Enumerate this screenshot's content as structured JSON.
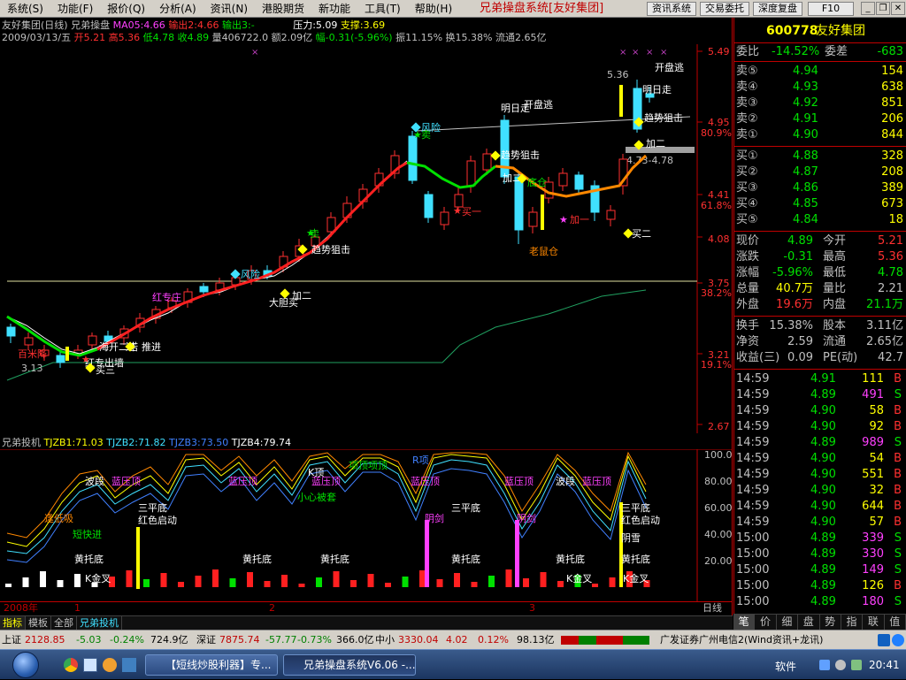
{
  "menu": {
    "items": [
      "系统(S)",
      "功能(F)",
      "报价(Q)",
      "分析(A)",
      "资讯(N)",
      "港股期货",
      "新功能",
      "工具(T)",
      "帮助(H)"
    ],
    "app_title": "兄弟操盘系统[友好集团]",
    "buttons": [
      "资讯系统",
      "交易委托",
      "深度复盘",
      "F10"
    ]
  },
  "info": {
    "stock_name": "友好集团(日线)",
    "system": "兄弟操盘",
    "ma": "MA05:4.66",
    "out2": "输出2:4.66",
    "out3": "输出3:-",
    "pressure": "压力:5.09",
    "support": "支撑:3.69",
    "date": "2009/03/13/五",
    "open": "开5.21",
    "high": "高5.36",
    "low": "低4.78",
    "close": "收4.89",
    "volume": "量406722.0",
    "amount": "额2.09亿",
    "amplitude_change": "幅-0.31(-5.96%)",
    "swing": "振11.15%",
    "turnover": "换15.38%",
    "float": "流通2.65亿"
  },
  "price_axis": {
    "labels": [
      "5.49",
      "4.95",
      "80.9%",
      "4.41",
      "61.8%",
      "4.08",
      "3.75",
      "38.2%",
      "3.21",
      "19.1%",
      "2.67"
    ],
    "current_box": "4.73-4.78"
  },
  "annotations": {
    "main": [
      "5.36",
      "开盘逃",
      "明日走",
      "趋势狙击",
      "加二",
      "风险",
      "卖",
      "明日走",
      "开盘逃",
      "趋势狙击",
      "加二",
      "底仓",
      "买一",
      "加一",
      "买二",
      "老鼠仓",
      "风险",
      "卖",
      "趋势狙击",
      "加二",
      "大胆买",
      "红专庄",
      "海开二诺",
      "进",
      "推进",
      "百米降",
      "3.13",
      "红专出墙",
      "买三"
    ],
    "indicator": [
      "波段",
      "蓝压顶",
      "蓝压顶",
      "K顶",
      "蓝压顶",
      "项顶项顶",
      "R项",
      "蓝压顶",
      "蓝压顶",
      "波段",
      "蓝压顶",
      "逢低吸",
      "短快进",
      "三平底",
      "红色启动",
      "小心被套",
      "阴剑",
      "三平底",
      "阴剑",
      "三平底",
      "红色启动",
      "阴雪",
      "黄托底",
      "黄托底",
      "黄托底",
      "黄托底",
      "黄托底",
      "黄托底",
      "K金叉",
      "K金叉",
      "K金叉"
    ]
  },
  "indicator": {
    "header_name": "兄弟投机",
    "tj1": "TJZB1:71.03",
    "tj2": "TJZB2:71.82",
    "tj3": "TJZB3:73.50",
    "tj4": "TJZB4:79.74",
    "axis": [
      "100.00",
      "80.00",
      "60.00",
      "40.00",
      "20.00"
    ]
  },
  "time_axis": {
    "labels": [
      "2008年",
      "1",
      "2",
      "3"
    ],
    "period": "日线"
  },
  "bottom_tabs": [
    "指标",
    "模板",
    "全部",
    "兄弟投机"
  ],
  "right_panel": {
    "code": "600778",
    "name": "友好集团",
    "weibi_label": "委比",
    "weibi": "-14.52%",
    "weicha_label": "委差",
    "weicha": "-683",
    "sells": [
      {
        "label": "卖⑤",
        "price": "4.94",
        "vol": "154"
      },
      {
        "label": "卖④",
        "price": "4.93",
        "vol": "638"
      },
      {
        "label": "卖③",
        "price": "4.92",
        "vol": "851"
      },
      {
        "label": "卖②",
        "price": "4.91",
        "vol": "206"
      },
      {
        "label": "卖①",
        "price": "4.90",
        "vol": "844"
      }
    ],
    "buys": [
      {
        "label": "买①",
        "price": "4.88",
        "vol": "328"
      },
      {
        "label": "买②",
        "price": "4.87",
        "vol": "208"
      },
      {
        "label": "买③",
        "price": "4.86",
        "vol": "389"
      },
      {
        "label": "买④",
        "price": "4.85",
        "vol": "673"
      },
      {
        "label": "买⑤",
        "price": "4.84",
        "vol": "18"
      }
    ],
    "stats": [
      {
        "l1": "现价",
        "v1": "4.89",
        "l2": "今开",
        "v2": "5.21"
      },
      {
        "l1": "涨跌",
        "v1": "-0.31",
        "l2": "最高",
        "v2": "5.36"
      },
      {
        "l1": "涨幅",
        "v1": "-5.96%",
        "l2": "最低",
        "v2": "4.78"
      },
      {
        "l1": "总量",
        "v1": "40.7万",
        "l2": "量比",
        "v2": "2.21"
      },
      {
        "l1": "外盘",
        "v1": "19.6万",
        "l2": "内盘",
        "v2": "21.1万"
      }
    ],
    "stats2": [
      {
        "l1": "换手",
        "v1": "15.38%",
        "l2": "股本",
        "v2": "3.11亿"
      },
      {
        "l1": "净资",
        "v1": "2.59",
        "l2": "流通",
        "v2": "2.65亿"
      },
      {
        "l1": "收益(三)",
        "v1": "0.09",
        "l2": "PE(动)",
        "v2": "42.7"
      }
    ],
    "ticks": [
      {
        "t": "14:59",
        "p": "4.91",
        "v": "111",
        "s": "B"
      },
      {
        "t": "14:59",
        "p": "4.89",
        "v": "491",
        "s": "S"
      },
      {
        "t": "14:59",
        "p": "4.90",
        "v": "58",
        "s": "B"
      },
      {
        "t": "14:59",
        "p": "4.90",
        "v": "92",
        "s": "B"
      },
      {
        "t": "14:59",
        "p": "4.89",
        "v": "989",
        "s": "S"
      },
      {
        "t": "14:59",
        "p": "4.90",
        "v": "54",
        "s": "B"
      },
      {
        "t": "14:59",
        "p": "4.90",
        "v": "551",
        "s": "B"
      },
      {
        "t": "14:59",
        "p": "4.90",
        "v": "32",
        "s": "B"
      },
      {
        "t": "14:59",
        "p": "4.90",
        "v": "644",
        "s": "B"
      },
      {
        "t": "14:59",
        "p": "4.90",
        "v": "57",
        "s": "B"
      },
      {
        "t": "15:00",
        "p": "4.89",
        "v": "339",
        "s": "S"
      },
      {
        "t": "15:00",
        "p": "4.89",
        "v": "330",
        "s": "S"
      },
      {
        "t": "15:00",
        "p": "4.89",
        "v": "149",
        "s": "S"
      },
      {
        "t": "15:00",
        "p": "4.89",
        "v": "126",
        "s": "B"
      },
      {
        "t": "15:00",
        "p": "4.89",
        "v": "180",
        "s": "S"
      }
    ],
    "tabs": [
      "笔",
      "价",
      "细",
      "盘",
      "势",
      "指",
      "联",
      "值"
    ]
  },
  "status": {
    "sh_label": "上证",
    "sh": "2128.85",
    "sh_chg": "-5.03",
    "sh_pct": "-0.24%",
    "sh_amt": "724.9亿",
    "sz_label": "深证",
    "sz": "7875.74",
    "sz_chg": "-57.77",
    "sz_pct": "-0.73%",
    "sz_amt": "366.0亿",
    "zx_label": "中小",
    "zx": "3330.04",
    "zx_chg": "4.02",
    "zx_pct": "0.12%",
    "zx_amt": "98.13亿",
    "broker": "广发证券广州电信2(Wind资讯+龙讯)"
  },
  "taskbar": {
    "btn1": "【短线炒股利器】专...",
    "btn2": "兄弟操盘系统V6.06 -...",
    "tray_label": "软件",
    "clock": "20:41"
  },
  "colors": {
    "up": "#ff3030",
    "down": "#40e0ff",
    "accent": "#c00000",
    "green": "#00e000",
    "yellow": "#ffff00"
  }
}
